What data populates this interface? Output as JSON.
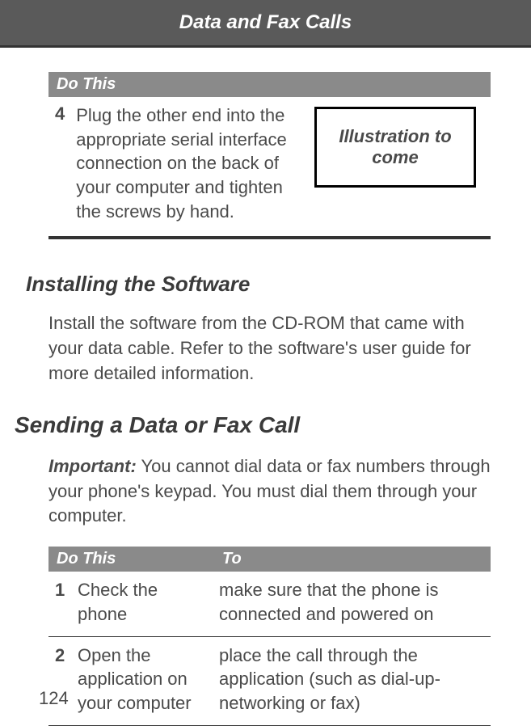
{
  "header": {
    "title": "Data and Fax Calls"
  },
  "table1": {
    "header_label": "Do This",
    "row": {
      "num": "4",
      "text": "Plug the other end into the appropriate serial interface connection on the back of your computer and tighten the screws by hand."
    },
    "illustration_placeholder": "Illustration to come"
  },
  "section_install": {
    "heading": "Installing the Software",
    "para": "Install the software from the CD-ROM that came with your data cable. Refer to the software's user guide for more detailed information."
  },
  "section_sending": {
    "heading": "Sending a Data or Fax Call",
    "important_label": "Important:",
    "important_text": " You cannot dial data or fax numbers through your phone's keypad.  You must dial them through your computer."
  },
  "table2": {
    "header_col1": "Do This",
    "header_col2": "To",
    "rows": [
      {
        "num": "1",
        "action": "Check the phone",
        "purpose": "make sure that the phone is connected and powered on"
      },
      {
        "num": "2",
        "action": "Open the application on your computer",
        "purpose": "place the call through the application (such as dial-up-networking or fax)"
      }
    ]
  },
  "page_number": "124"
}
